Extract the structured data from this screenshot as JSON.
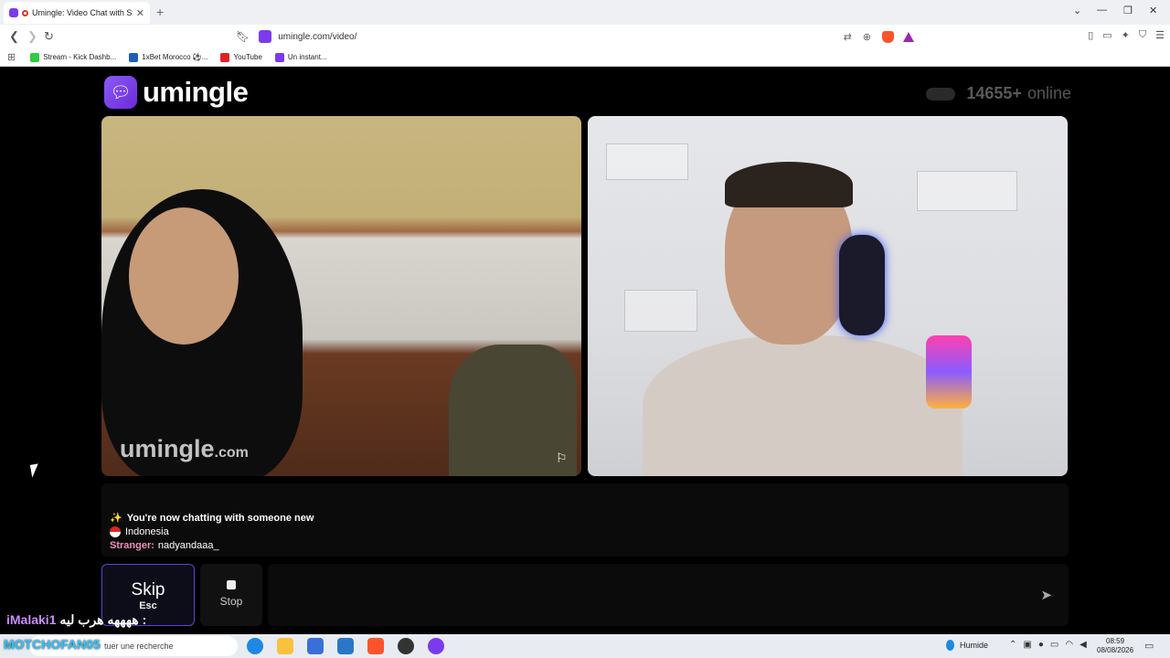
{
  "browser": {
    "tab_title": "Umingle: Video Chat with Str",
    "tab_close": "✕",
    "new_tab": "+",
    "url": "umingle.com/video/",
    "bookmarks": [
      {
        "label": "Stream - Kick Dashb...",
        "color": "#2ecc40"
      },
      {
        "label": "1xBet Morocco ⚽...",
        "color": "#1e5fb8"
      },
      {
        "label": "YouTube",
        "color": "#e02424"
      },
      {
        "label": "Un instant...",
        "color": "#7c3aed"
      }
    ]
  },
  "page": {
    "logo_text": "umingle",
    "online_count": "14655+",
    "online_label": "online",
    "watermark_main": "umingle",
    "watermark_suffix": ".com"
  },
  "chat": {
    "system_message": "You're now chatting with someone new",
    "country": "Indonesia",
    "stranger_label": "Stranger:",
    "stranger_name": "nadyandaaa_"
  },
  "controls": {
    "skip_label": "Skip",
    "skip_key": "Esc",
    "stop_label": "Stop",
    "send_icon": "send-icon"
  },
  "overlay": {
    "user1": "iMalaki1",
    "user1_message": ": ههههه هرب ليه",
    "user2": "MOTCHOFAN05"
  },
  "taskbar": {
    "search_text": "tuer une recherche",
    "weather": "Humide",
    "time": "08:59",
    "date": "08/08/2026"
  },
  "colors": {
    "brand": "#7c3aed",
    "skip_border": "#5b46d6",
    "stranger": "#f08bbd"
  }
}
